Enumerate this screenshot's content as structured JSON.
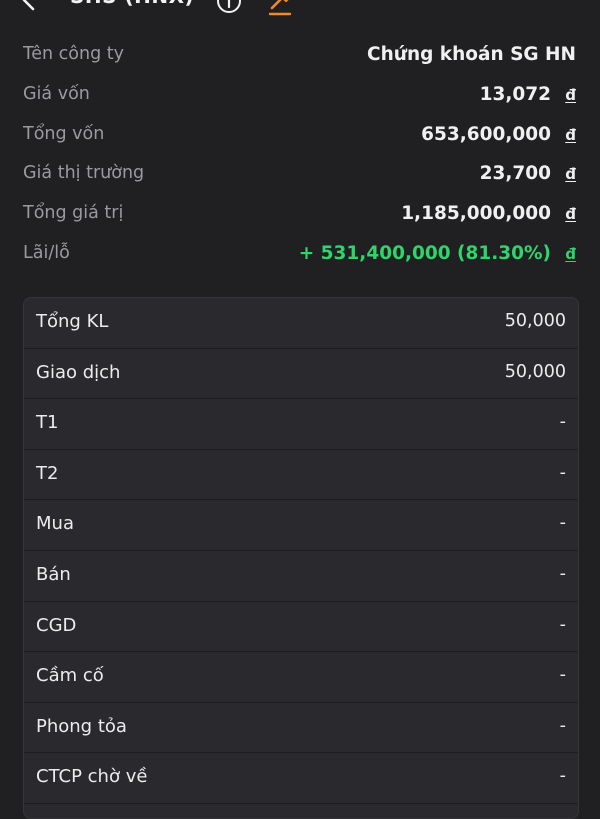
{
  "header": {
    "title": "SHS (HNX)",
    "back_icon": "chevron-left-icon",
    "info_icon": "info-circle-icon",
    "tool_icon": "hammer-icon"
  },
  "summary": [
    {
      "label": "Tên công ty",
      "value": "Chứng khoán SG HN",
      "currency": ""
    },
    {
      "label": "Giá vốn",
      "value": "13,072",
      "currency": "đ"
    },
    {
      "label": "Tổng vốn",
      "value": "653,600,000",
      "currency": "đ"
    },
    {
      "label": "Giá thị trường",
      "value": "23,700",
      "currency": "đ"
    },
    {
      "label": "Tổng giá trị",
      "value": "1,185,000,000",
      "currency": "đ"
    },
    {
      "label": "Lãi/lỗ",
      "value": "+ 531,400,000 (81.30%)",
      "currency": "đ"
    }
  ],
  "details": [
    {
      "label": "Tổng KL",
      "value": "50,000"
    },
    {
      "label": "Giao dịch",
      "value": "50,000"
    },
    {
      "label": "T1",
      "value": "-"
    },
    {
      "label": "T2",
      "value": "-"
    },
    {
      "label": "Mua",
      "value": "-"
    },
    {
      "label": "Bán",
      "value": "-"
    },
    {
      "label": "CGD",
      "value": "-"
    },
    {
      "label": "Cầm cố",
      "value": "-"
    },
    {
      "label": "Phong tỏa",
      "value": "-"
    },
    {
      "label": "CTCP chờ về",
      "value": "-"
    }
  ],
  "colors": {
    "background": "#202023",
    "card": "#2a2a2e",
    "profit": "#2fd46a",
    "accent_orange": "#f0892c",
    "label_gray": "#9a9aa0"
  }
}
